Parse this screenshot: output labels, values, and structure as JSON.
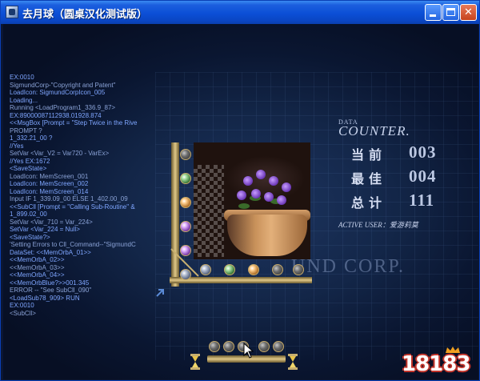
{
  "window": {
    "title": "去月球（圆桌汉化测试版）",
    "minimize_icon": "minimize-icon",
    "maximize_icon": "maximize-icon",
    "close_icon": "close-icon",
    "close_glyph": "✕"
  },
  "console_lines": [
    "EX:0010",
    "SigmundCorp-\"Copyright and Patent\"",
    "LoadIcon: SigmundCorpIcon_005",
    "Loading...",
    "Running <LoadProgram1_336.9_87>",
    "EX:89000087112938.01928.874",
    "<<MsgBox [Prompt = \"Step Twice in the Rive",
    "PROMPT ?",
    "  1_332.21_00 ?",
    "//Yes",
    "SetVar <Var_V2 = Var720 - VarEx>",
    "//Yes    EX:1672",
    "<SaveState>",
    "LoadIcon: MemScreen_001",
    "LoadIcon: MemScreen_002",
    "LoadIcon: MemScreen_014",
    "Input IF 1_339.09_00 ELSE 1_402.00_09",
    "<<SubCll [Prompt = \"Calling Sub-Routine\" &",
    "  1_899.02_00",
    "SetVar <Var_710 = Var_224>",
    "SetVar <Var_224 = Null>",
    "<SaveState?>",
    "'Setting Errors to Cll_Command--\"SigmundC",
    "DataSet: <<MemOrbA_01>>",
    "  <<MemOrbA_02>>",
    "  <<MemOrbA_03>>",
    "  <<MemOrbA_04>>",
    "  <<MemOrbBlue?>>001.345",
    "ERROR -- \"See SubCll_090\"",
    "  <LoadSub78_909> RUN",
    "EX:0010",
    "  <SubCll>"
  ],
  "counter": {
    "data_label": "DATA",
    "title": "COUNTER.",
    "rows": [
      {
        "label": "当前",
        "value": "003"
      },
      {
        "label": "最佳",
        "value": "004"
      },
      {
        "label": "总计",
        "value": "111"
      }
    ],
    "active_user": "ACTIVE USER：爱游莉莫"
  },
  "corp_text": "UND CORP.",
  "logo": {
    "number": "18183"
  },
  "colors": {
    "title_bar": "#0b4fd6",
    "console_text": "#7fa6ff",
    "counter_text": "#d6def2",
    "gold_frame": "#e0c888",
    "logo_red": "#c2342a"
  }
}
